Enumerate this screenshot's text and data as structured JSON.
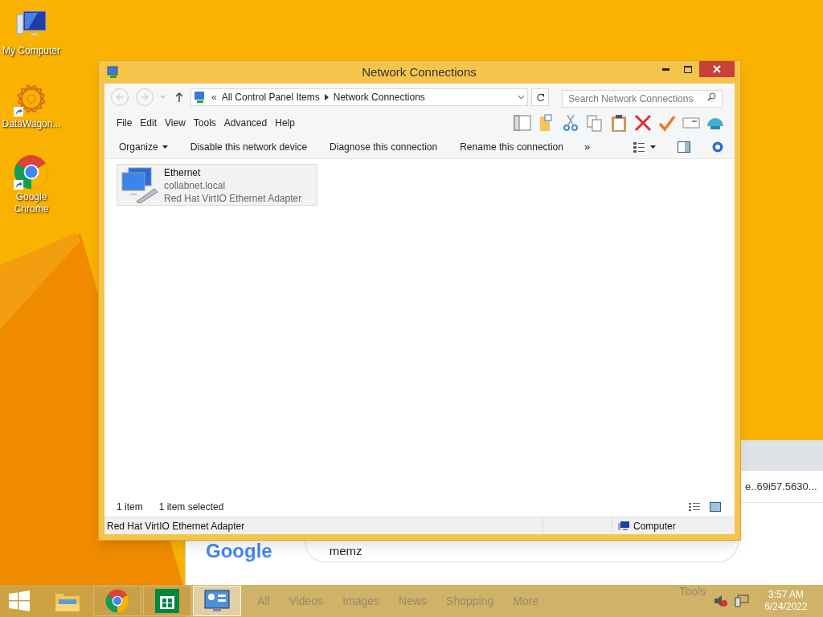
{
  "desktop_icons": [
    {
      "kind": "computer",
      "label": "My Computer",
      "shortcut": false
    },
    {
      "kind": "star",
      "label": "DataWagon...",
      "shortcut": true
    },
    {
      "kind": "chrome",
      "label": "Google Chrome",
      "shortcut": true
    }
  ],
  "browser": {
    "address": "e..69i57.5630...",
    "logo": "Google",
    "search_value": "memz",
    "tabs": [
      "All",
      "Videos",
      "Images",
      "News",
      "Shopping",
      "More"
    ],
    "tools": "Tools"
  },
  "window": {
    "title": "Network Connections",
    "breadcrumb_overflow": "«",
    "breadcrumbs": [
      "All Control Panel Items",
      "Network Connections"
    ],
    "search": {
      "placeholder": "Search Network Connections"
    },
    "menu": [
      "File",
      "Edit",
      "View",
      "Tools",
      "Advanced",
      "Help"
    ],
    "commands": [
      {
        "label": "Organize",
        "dropdown": true
      },
      {
        "label": "Disable this network device",
        "dropdown": false
      },
      {
        "label": "Diagnose this connection",
        "dropdown": false
      },
      {
        "label": "Rename this connection",
        "dropdown": false
      }
    ],
    "more": "»",
    "items": [
      {
        "name": "Ethernet",
        "network": "collabnet.local",
        "adapter": "Red Hat VirtIO Ethernet Adapter",
        "selected": true
      }
    ],
    "status": {
      "count": "1 item",
      "selection": "1 item selected"
    },
    "details_bar": {
      "text": "Red Hat VirtIO Ethernet Adapter",
      "zone": "Computer"
    }
  },
  "taskbar": {
    "apps": [
      {
        "kind": "explorer",
        "running": false,
        "selected": false
      },
      {
        "kind": "chrome",
        "running": true,
        "selected": false
      },
      {
        "kind": "store",
        "running": true,
        "selected": false
      },
      {
        "kind": "control-panel",
        "running": true,
        "selected": true
      }
    ],
    "time": "3:57 AM",
    "date": "6/24/2022"
  }
}
